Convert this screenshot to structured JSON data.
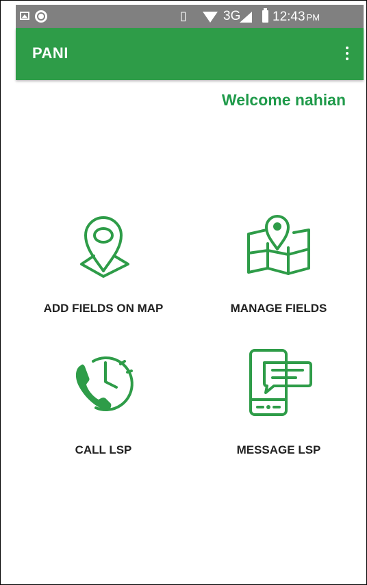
{
  "status_bar": {
    "icons": [
      "image-icon",
      "circle-icon",
      "vibrate-icon",
      "wifi-icon",
      "signal-icon",
      "battery-icon"
    ],
    "vibrate_glyph": "▯",
    "network": "3G",
    "time": "12:43",
    "ampm": "PM"
  },
  "app_bar": {
    "title": "PANI",
    "menu_icon": "overflow-menu-icon",
    "color": "#2e9c48"
  },
  "welcome_text": "Welcome nahian",
  "colors": {
    "accent": "#1f9a4a",
    "icon_green": "#2e9c48"
  },
  "actions": [
    {
      "label": "ADD FIELDS ON MAP",
      "icon": "map-pin-icon"
    },
    {
      "label": "MANAGE FIELDS",
      "icon": "folded-map-icon"
    },
    {
      "label": "CALL LSP",
      "icon": "phone-clock-icon"
    },
    {
      "label": "MESSAGE LSP",
      "icon": "mobile-message-icon"
    }
  ]
}
